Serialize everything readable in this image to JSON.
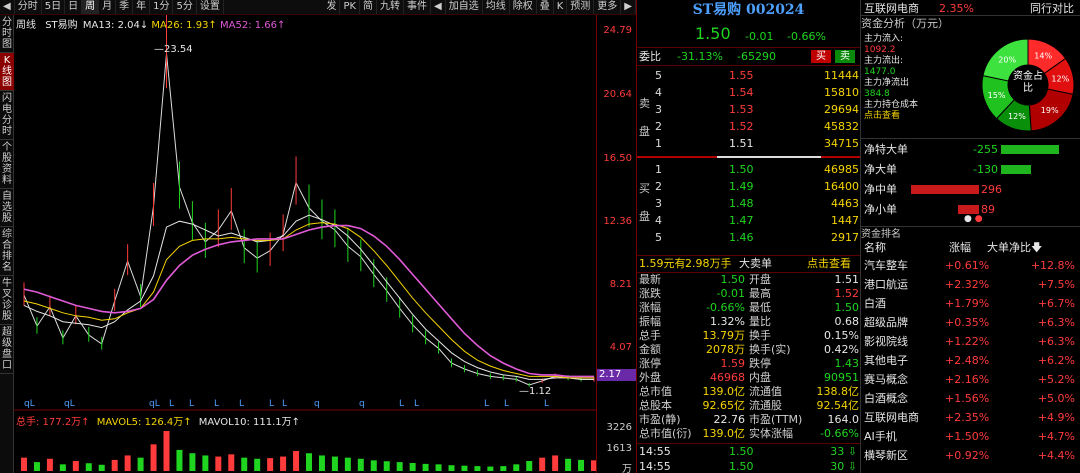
{
  "toolbar": {
    "items": [
      "分时",
      "5日",
      "日",
      "周",
      "月",
      "季",
      "年",
      "1分",
      "5分",
      "设置"
    ],
    "right_items": [
      "发",
      "PK",
      "简",
      "九转",
      "事件",
      "加自选",
      "均线",
      "除权",
      "叠",
      "K",
      "预测",
      "更多"
    ],
    "nav_icons": [
      "◀",
      "▶"
    ]
  },
  "sidenav": [
    "分时图",
    "K线图",
    "闪电分时",
    "个股资料",
    "自选股",
    "综合排名",
    "牛叉诊股",
    "超级盘口"
  ],
  "chart": {
    "legend_label": "周线",
    "stock_name": "ST易购",
    "ma13": "MA13: 2.04↓",
    "ma26": "MA26: 1.93↑",
    "ma52": "MA52: 1.66↑",
    "high_label": "23.54",
    "low_label": "1.12",
    "q_markers": [
      "qL",
      "qL",
      "qL",
      "L",
      "L",
      "L",
      "L",
      "L",
      "L",
      "q",
      "q",
      "L",
      "L",
      "L",
      "L",
      "L"
    ],
    "vol_label": "总手: 177.2万↑",
    "mavol5": "MAVOL5: 126.4万↑",
    "mavol10": "MAVOL10: 111.1万↑",
    "yticks": [
      "24.79",
      "20.64",
      "16.50",
      "12.36",
      "8.21",
      "4.07",
      "2.17"
    ],
    "vol_ticks": [
      "3226",
      "1613",
      "万"
    ]
  },
  "chart_data": {
    "type": "line",
    "title": "ST易购",
    "xlabel": "",
    "ylabel": "",
    "ylim": [
      1.12,
      24.79
    ],
    "series": [
      {
        "name": "price",
        "values": [
          7.2,
          5.1,
          6.4,
          4.3,
          5.8,
          4.5,
          3.9,
          6.8,
          9.5,
          7.1,
          13.2,
          23.54,
          14.5,
          12.1,
          10.8,
          11.6,
          12.9,
          10.4,
          9.7,
          10.2,
          11.3,
          14.8,
          13.1,
          12.2,
          11.6,
          10.5,
          9.8,
          8.6,
          7.5,
          6.3,
          5.2,
          4.3,
          3.6,
          2.6,
          2.2,
          1.9,
          1.7,
          1.6,
          1.5,
          1.12,
          1.4,
          1.7,
          1.6,
          1.5,
          1.5
        ]
      },
      {
        "name": "MA13",
        "values": [
          6.5,
          6.1,
          5.8,
          5.4,
          5.3,
          5.2,
          5.0,
          5.4,
          6.2,
          6.8,
          8.5,
          11.8,
          12.2,
          12.0,
          11.6,
          11.2,
          11.4,
          11.1,
          10.8,
          10.9,
          11.2,
          12.2,
          12.6,
          12.3,
          11.9,
          11.2,
          10.3,
          9.2,
          8.1,
          7.0,
          5.9,
          4.9,
          4.1,
          3.3,
          2.7,
          2.3,
          2.0,
          1.8,
          1.7,
          1.5,
          1.5,
          1.6,
          1.6,
          1.5,
          1.5
        ]
      },
      {
        "name": "MA26",
        "values": [
          6.8,
          6.6,
          6.3,
          6.0,
          5.8,
          5.7,
          5.5,
          5.6,
          6.0,
          6.3,
          7.4,
          9.6,
          10.5,
          10.9,
          11.0,
          11.0,
          11.1,
          11.0,
          10.9,
          10.9,
          11.0,
          11.6,
          12.0,
          12.1,
          12.0,
          11.7,
          11.1,
          10.2,
          9.2,
          8.1,
          7.0,
          6.0,
          5.1,
          4.2,
          3.4,
          2.8,
          2.4,
          2.1,
          1.9,
          1.7,
          1.7,
          1.7,
          1.6,
          1.6,
          1.6
        ]
      },
      {
        "name": "MA52",
        "values": [
          7.6,
          7.4,
          7.1,
          6.8,
          6.5,
          6.3,
          6.1,
          6.0,
          6.1,
          6.3,
          6.9,
          8.2,
          9.2,
          9.9,
          10.3,
          10.6,
          10.8,
          10.9,
          11.0,
          11.0,
          11.0,
          11.3,
          11.6,
          11.8,
          11.9,
          11.9,
          11.7,
          11.2,
          10.5,
          9.6,
          8.6,
          7.6,
          6.6,
          5.6,
          4.6,
          3.8,
          3.1,
          2.6,
          2.2,
          1.9,
          1.8,
          1.8,
          1.7,
          1.7,
          1.7
        ]
      }
    ],
    "volumes": [
      60,
      40,
      55,
      30,
      45,
      35,
      28,
      50,
      70,
      60,
      120,
      180,
      95,
      80,
      70,
      65,
      75,
      60,
      55,
      58,
      65,
      90,
      80,
      70,
      65,
      60,
      55,
      48,
      44,
      40,
      36,
      32,
      30,
      26,
      24,
      22,
      20,
      22,
      30,
      45,
      60,
      70,
      55,
      50,
      48
    ]
  },
  "quote": {
    "title": "ST易购 002024",
    "price": "1.50",
    "change": "-0.01",
    "change_pct": "-0.66%",
    "weibi_label": "委比",
    "weibi_pct": "-31.13%",
    "weibi_val": "-65290",
    "buy_btn": "买",
    "sell_btn": "卖",
    "sell_label": "卖盘",
    "buy_label": "买盘",
    "sell_levels": [
      {
        "lvl": "5",
        "price": "1.55",
        "vol": "11444"
      },
      {
        "lvl": "4",
        "price": "1.54",
        "vol": "15810"
      },
      {
        "lvl": "3",
        "price": "1.53",
        "vol": "29694"
      },
      {
        "lvl": "2",
        "price": "1.52",
        "vol": "45832"
      },
      {
        "lvl": "1",
        "price": "1.51",
        "vol": "34715"
      }
    ],
    "buy_levels": [
      {
        "lvl": "1",
        "price": "1.50",
        "vol": "46985"
      },
      {
        "lvl": "2",
        "price": "1.49",
        "vol": "16400"
      },
      {
        "lvl": "3",
        "price": "1.48",
        "vol": "4463"
      },
      {
        "lvl": "4",
        "price": "1.47",
        "vol": "1447"
      },
      {
        "lvl": "5",
        "price": "1.46",
        "vol": "2917"
      }
    ],
    "big_order": {
      "price": "1.59元有",
      "amt": "2.98万手",
      "label": "大卖单",
      "link": "点击查看"
    },
    "stats": [
      {
        "l1": "最新",
        "v1": "1.50",
        "c1": "green",
        "l2": "开盘",
        "v2": "1.51",
        "c2": "white"
      },
      {
        "l1": "涨跌",
        "v1": "-0.01",
        "c1": "green",
        "l2": "最高",
        "v2": "1.52",
        "c2": "red"
      },
      {
        "l1": "涨幅",
        "v1": "-0.66%",
        "c1": "green",
        "l2": "最低",
        "v2": "1.50",
        "c2": "green"
      },
      {
        "l1": "振幅",
        "v1": "1.32%",
        "c1": "white",
        "l2": "量比",
        "v2": "0.68",
        "c2": "white"
      },
      {
        "l1": "总手",
        "v1": "13.79万",
        "c1": "yellow",
        "l2": "换手",
        "v2": "0.15%",
        "c2": "white"
      },
      {
        "l1": "金额",
        "v1": "2078万",
        "c1": "yellow",
        "l2": "换手(实)",
        "v2": "0.42%",
        "c2": "white"
      },
      {
        "l1": "涨停",
        "v1": "1.59",
        "c1": "red",
        "l2": "跌停",
        "v2": "1.43",
        "c2": "green"
      },
      {
        "l1": "外盘",
        "v1": "46968",
        "c1": "red",
        "l2": "内盘",
        "v2": "90951",
        "c2": "green"
      },
      {
        "l1": "总市值",
        "v1": "139.0亿",
        "c1": "yellow",
        "l2": "流通值",
        "v2": "138.8亿",
        "c2": "yellow"
      },
      {
        "l1": "总股本",
        "v1": "92.65亿",
        "c1": "yellow",
        "l2": "流通股",
        "v2": "92.54亿",
        "c2": "yellow"
      },
      {
        "l1": "市盈(静)",
        "v1": "22.76",
        "c1": "white",
        "l2": "市盈(TTM)",
        "v2": "164.0",
        "c2": "white"
      },
      {
        "l1": "总市值(衍)",
        "v1": "139.0亿",
        "c1": "yellow",
        "l2": "实体涨幅",
        "v2": "-0.66%",
        "c2": "green"
      }
    ],
    "ticks": [
      {
        "time": "14:55",
        "price": "1.50",
        "vol": "33"
      },
      {
        "time": "14:55",
        "price": "1.50",
        "vol": "30"
      }
    ]
  },
  "sector": {
    "name": "互联网电商",
    "change": "2.35%",
    "peer_link": "同行对比",
    "fund_title": "资金分析（万元）",
    "main_in_label": "主力流入:",
    "main_in": "1092.2",
    "main_out_label": "主力流出:",
    "main_out": "1477.0",
    "main_net_label": "主力净流出",
    "main_net": "384.8",
    "cost_label": "主力持仓成本",
    "cost_link": "点击查看",
    "donut_center": "资金占比",
    "donut": [
      {
        "label": "14%",
        "value": 14,
        "color": "#ff2a2a"
      },
      {
        "label": "12%",
        "value": 12,
        "color": "#e01010"
      },
      {
        "label": "19%",
        "value": 19,
        "color": "#b00000"
      },
      {
        "label": "12%",
        "value": 12,
        "color": "#0a8f0a"
      },
      {
        "label": "15%",
        "value": 15,
        "color": "#1fc21f"
      },
      {
        "label": "20%",
        "value": 20,
        "color": "#3ee23e"
      }
    ],
    "net_flows": [
      {
        "label": "净特大单",
        "value": "-255",
        "color": "green",
        "frac": 0.72
      },
      {
        "label": "净大单",
        "value": "-130",
        "color": "green",
        "frac": 0.38
      },
      {
        "label": "净中单",
        "value": "296",
        "color": "red",
        "frac": 0.85
      },
      {
        "label": "净小单",
        "value": "89",
        "color": "red",
        "frac": 0.26
      }
    ],
    "rank_title": "资金排名",
    "rank_headers": [
      "名称",
      "涨幅",
      "大单净比"
    ],
    "rank_rows": [
      {
        "name": "汽车整车",
        "chg": "+0.61%",
        "net": "+12.8%"
      },
      {
        "name": "港口航运",
        "chg": "+2.32%",
        "net": "+7.5%"
      },
      {
        "name": "白酒",
        "chg": "+1.79%",
        "net": "+6.7%"
      },
      {
        "name": "超级品牌",
        "chg": "+0.35%",
        "net": "+6.3%"
      },
      {
        "name": "影视院线",
        "chg": "+1.22%",
        "net": "+6.3%"
      },
      {
        "name": "其他电子",
        "chg": "+2.48%",
        "net": "+6.2%"
      },
      {
        "name": "赛马概念",
        "chg": "+2.16%",
        "net": "+5.2%"
      },
      {
        "name": "白酒概念",
        "chg": "+1.56%",
        "net": "+5.0%"
      },
      {
        "name": "互联网电商",
        "chg": "+2.35%",
        "net": "+4.9%"
      },
      {
        "name": "AI手机",
        "chg": "+1.50%",
        "net": "+4.7%"
      },
      {
        "name": "横琴新区",
        "chg": "+0.92%",
        "net": "+4.4%"
      }
    ]
  }
}
